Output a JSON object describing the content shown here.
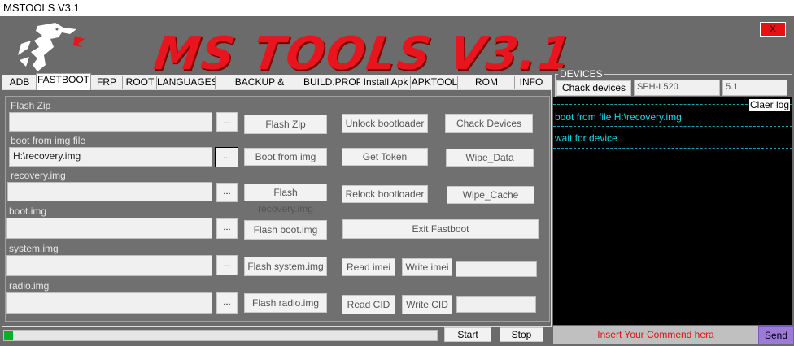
{
  "window": {
    "title": "MSTOOLS V3.1",
    "close_label": "X"
  },
  "banner": {
    "text": "MS TOOLS V3.1"
  },
  "tabs": [
    "ADB",
    "FASTBOOT",
    "FRP",
    "ROOT",
    "LANGUAGES",
    "BACKUP & RESTOR",
    "BUILD.PROP",
    "Install Apk",
    "APKTOOL",
    "ROM TOOLS",
    "INFO"
  ],
  "active_tab": "FASTBOOT",
  "fastboot": {
    "rows": [
      {
        "label": "Flash Zip",
        "value": "",
        "browse": "...",
        "action": "Flash Zip"
      },
      {
        "label": "boot from img file",
        "value": "H:\\recovery.img",
        "browse": "...",
        "action": "Boot from img"
      },
      {
        "label": "recovery.img",
        "value": "",
        "browse": "...",
        "action": "Flash recovery.img"
      },
      {
        "label": "boot.img",
        "value": "",
        "browse": "...",
        "action": "Flash boot.img"
      },
      {
        "label": "system.img",
        "value": "",
        "browse": "...",
        "action": "Flash system.img"
      },
      {
        "label": "radio.img",
        "value": "",
        "browse": "...",
        "action": "Flash radio.img"
      }
    ],
    "buttons": {
      "unlock": "Unlock bootloader",
      "check_devices": "Chack Devices",
      "get_token": "Get Token",
      "wipe_data": "Wipe_Data",
      "relock": "Relock bootloader",
      "wipe_cache": "Wipe_Cache",
      "exit_fastboot": "Exit Fastboot",
      "read_imei": "Read imei",
      "write_imei": "Write imei",
      "read_cid": "Read CID",
      "write_cid": "Write CID"
    },
    "imei_value": "",
    "cid_value": ""
  },
  "progress": {
    "fraction": 0.02
  },
  "controls": {
    "start": "Start",
    "stop": "Stop"
  },
  "devices": {
    "group_label": "DEVICES",
    "check_button": "Chack devices",
    "model": "SPH-L520",
    "version": "5.1"
  },
  "log": {
    "clear_label": "Claer log",
    "lines": [
      "boot from file H:\\recovery.img",
      "wait for device"
    ]
  },
  "command": {
    "placeholder": "Insert Your Commend hera",
    "send_label": "Send"
  },
  "colors": {
    "banner": "#e8141e",
    "log_text": "#17d6e6",
    "progress": "#06b025",
    "send": "#9b7bd6"
  }
}
